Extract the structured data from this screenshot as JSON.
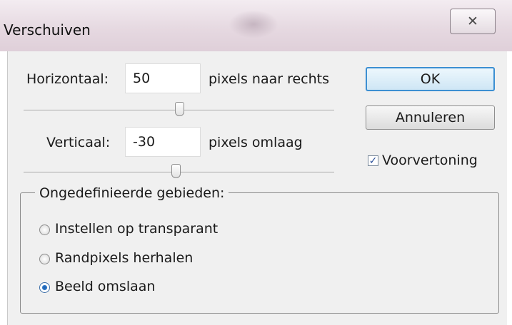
{
  "dialog": {
    "title": "Verschuiven",
    "close_glyph": "✕"
  },
  "horizontal": {
    "label": "Horizontaal:",
    "value": "50",
    "unit": "pixels naar rechts",
    "slider_value": 0.5
  },
  "vertical": {
    "label": "Verticaal:",
    "value": "-30",
    "unit": "pixels omlaag",
    "slider_value": 0.49
  },
  "buttons": {
    "ok": "OK",
    "cancel": "Annuleren"
  },
  "preview": {
    "label": "Voorvertoning",
    "checked": true,
    "check_glyph": "✓"
  },
  "undefined_areas": {
    "legend": "Ongedefinieerde gebieden:",
    "options": [
      {
        "label": "Instellen op transparant",
        "selected": false
      },
      {
        "label": "Randpixels herhalen",
        "selected": false
      },
      {
        "label": "Beeld omslaan",
        "selected": true
      }
    ]
  },
  "colors": {
    "accent": "#3c8fd2",
    "dialog_bg": "#f0f0f0",
    "titlebar": "#e6d9e1"
  },
  "icons": [
    "close-icon",
    "checkbox-checked-icon",
    "radio-icon"
  ]
}
